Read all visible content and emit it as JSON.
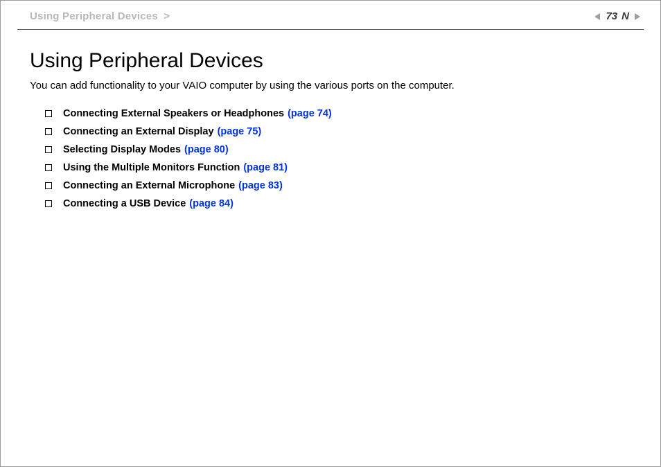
{
  "breadcrumb": {
    "text": "Using Peripheral Devices",
    "chevron": ">"
  },
  "pager": {
    "page_number": "73",
    "n_text": "N"
  },
  "title": "Using Peripheral Devices",
  "intro": "You can add functionality to your VAIO computer by using the various ports on the computer.",
  "items": [
    {
      "label": "Connecting External Speakers or Headphones",
      "page_ref": "(page 74)"
    },
    {
      "label": "Connecting an External Display",
      "page_ref": "(page 75)"
    },
    {
      "label": "Selecting Display Modes",
      "page_ref": "(page 80)"
    },
    {
      "label": "Using the Multiple Monitors Function",
      "page_ref": "(page 81)"
    },
    {
      "label": "Connecting an External Microphone",
      "page_ref": "(page 83)"
    },
    {
      "label": "Connecting a USB Device",
      "page_ref": "(page 84)"
    }
  ]
}
